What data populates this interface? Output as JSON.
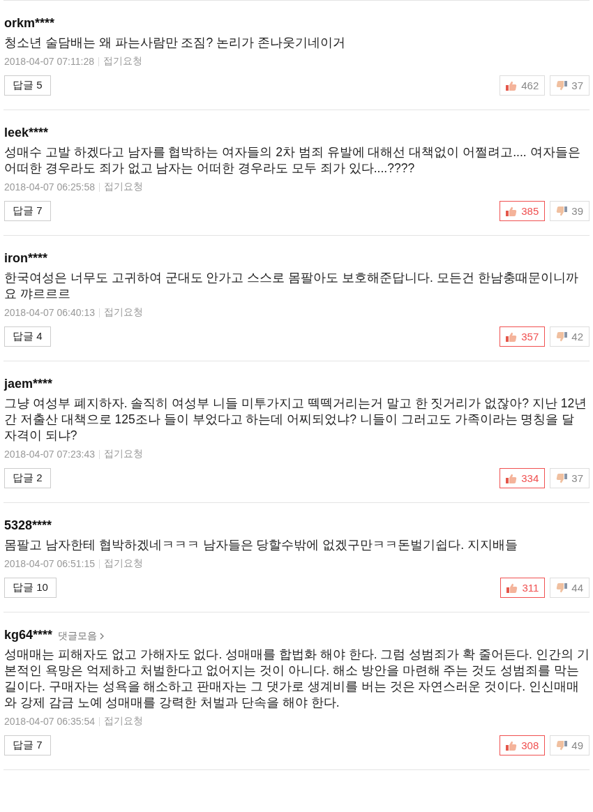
{
  "comments": [
    {
      "user": "orkm****",
      "text": "청소년 술담배는 왜 파는사람만 조짐? 논리가 존나웃기네이거",
      "date": "2018-04-07 07:11:28",
      "report": "접기요청",
      "reply": "답글 5",
      "likes": "462",
      "like_highlighted": false,
      "dislikes": "37"
    },
    {
      "user": "leek****",
      "text": "성매수 고발 하겠다고 남자를 협박하는 여자들의 2차 범죄 유발에 대해선 대책없이 어쩔려고.... 여자들은 어떠한 경우라도 죄가 없고 남자는 어떠한 경우라도 모두 죄가 있다....????",
      "date": "2018-04-07 06:25:58",
      "report": "접기요청",
      "reply": "답글 7",
      "likes": "385",
      "like_highlighted": true,
      "dislikes": "39"
    },
    {
      "user": "iron****",
      "text": "한국여성은 너무도 고귀하여 군대도 안가고 스스로 몸팔아도 보호해준답니다. 모든건 한남충때문이니까요 꺄르르르",
      "date": "2018-04-07 06:40:13",
      "report": "접기요청",
      "reply": "답글 4",
      "likes": "357",
      "like_highlighted": true,
      "dislikes": "42"
    },
    {
      "user": "jaem****",
      "text": "그냥 여성부 폐지하자. 솔직히 여성부 니들 미투가지고 떽떽거리는거 말고 한 짓거리가 없잖아? 지난 12년간 저출산 대책으로 125조나 들이 부었다고 하는데 어찌되었냐? 니들이 그러고도 가족이라는 명칭을 달 자격이 되냐?",
      "date": "2018-04-07 07:23:43",
      "report": "접기요청",
      "reply": "답글 2",
      "likes": "334",
      "like_highlighted": true,
      "dislikes": "37"
    },
    {
      "user": "5328****",
      "text": "몸팔고 남자한테 협박하겠네ㅋㅋㅋ 남자들은 당할수밖에 없겠구만ㅋㅋ돈벌기쉽다. 지지배들",
      "date": "2018-04-07 06:51:15",
      "report": "접기요청",
      "reply": "답글 10",
      "likes": "311",
      "like_highlighted": true,
      "dislikes": "44"
    },
    {
      "user": "kg64****",
      "collection": "댓글모음",
      "text": "성매매는 피해자도 없고 가해자도 없다. 성매매를 합법화 해야 한다. 그럼 성범죄가 확 줄어든다. 인간의 기본적인 욕망은 억제하고 처벌한다고 없어지는 것이 아니다. 해소 방안을 마련해 주는 것도 성범죄를 막는 길이다. 구매자는 성욕을 해소하고 판매자는 그 댓가로 생계비를 버는 것은 자연스러운 것이다. 인신매매와 강제 감금 노예 성매매를 강력한 처벌과 단속을 해야 한다.",
      "date": "2018-04-07 06:35:54",
      "report": "접기요청",
      "reply": "답글 7",
      "likes": "308",
      "like_highlighted": true,
      "dislikes": "49"
    }
  ]
}
